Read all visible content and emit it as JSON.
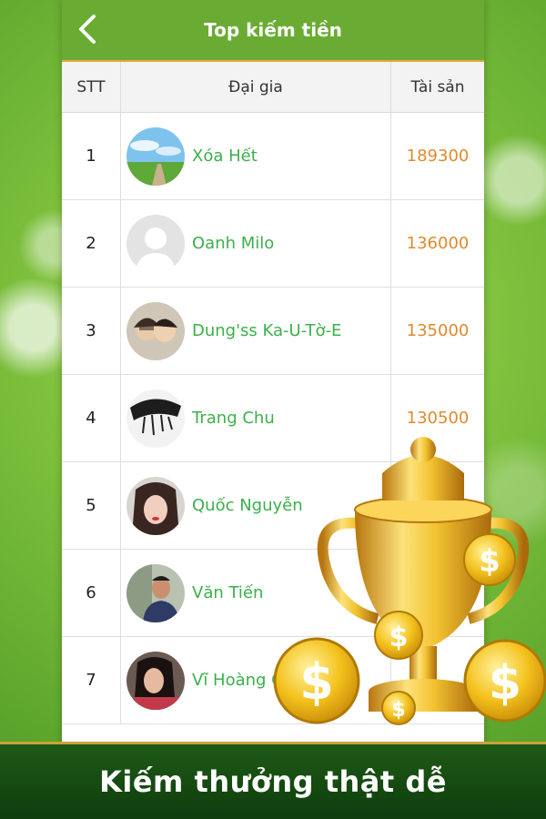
{
  "header": {
    "title": "Top kiếm tiền"
  },
  "table": {
    "columns": {
      "rank": "STT",
      "user": "Đại gia",
      "assets": "Tài sản"
    },
    "rows": [
      {
        "rank": "1",
        "name": "Xóa Hết",
        "assets": "189300"
      },
      {
        "rank": "2",
        "name": "Oanh Milo",
        "assets": "136000"
      },
      {
        "rank": "3",
        "name": "Dung'ss Ka-U-Tờ-E",
        "assets": "135000"
      },
      {
        "rank": "4",
        "name": "Trang Chu",
        "assets": "130500"
      },
      {
        "rank": "5",
        "name": "Quốc Nguyễn",
        "assets": ""
      },
      {
        "rank": "6",
        "name": "Văn Tiến",
        "assets": ""
      },
      {
        "rank": "7",
        "name": "Vĩ Hoàng Cô",
        "assets": ""
      }
    ]
  },
  "promo": {
    "text": "Kiếm thưởng thật dễ"
  },
  "colors": {
    "appbar": "#6aab33",
    "name": "#3bb04a",
    "assets": "#e08a2e",
    "bottom_bar": "#1e5a17",
    "gold": "#f2c230"
  },
  "icons": {
    "back": "chevron-left-icon",
    "trophy": "trophy-icon",
    "coin": "dollar-coin-icon"
  }
}
